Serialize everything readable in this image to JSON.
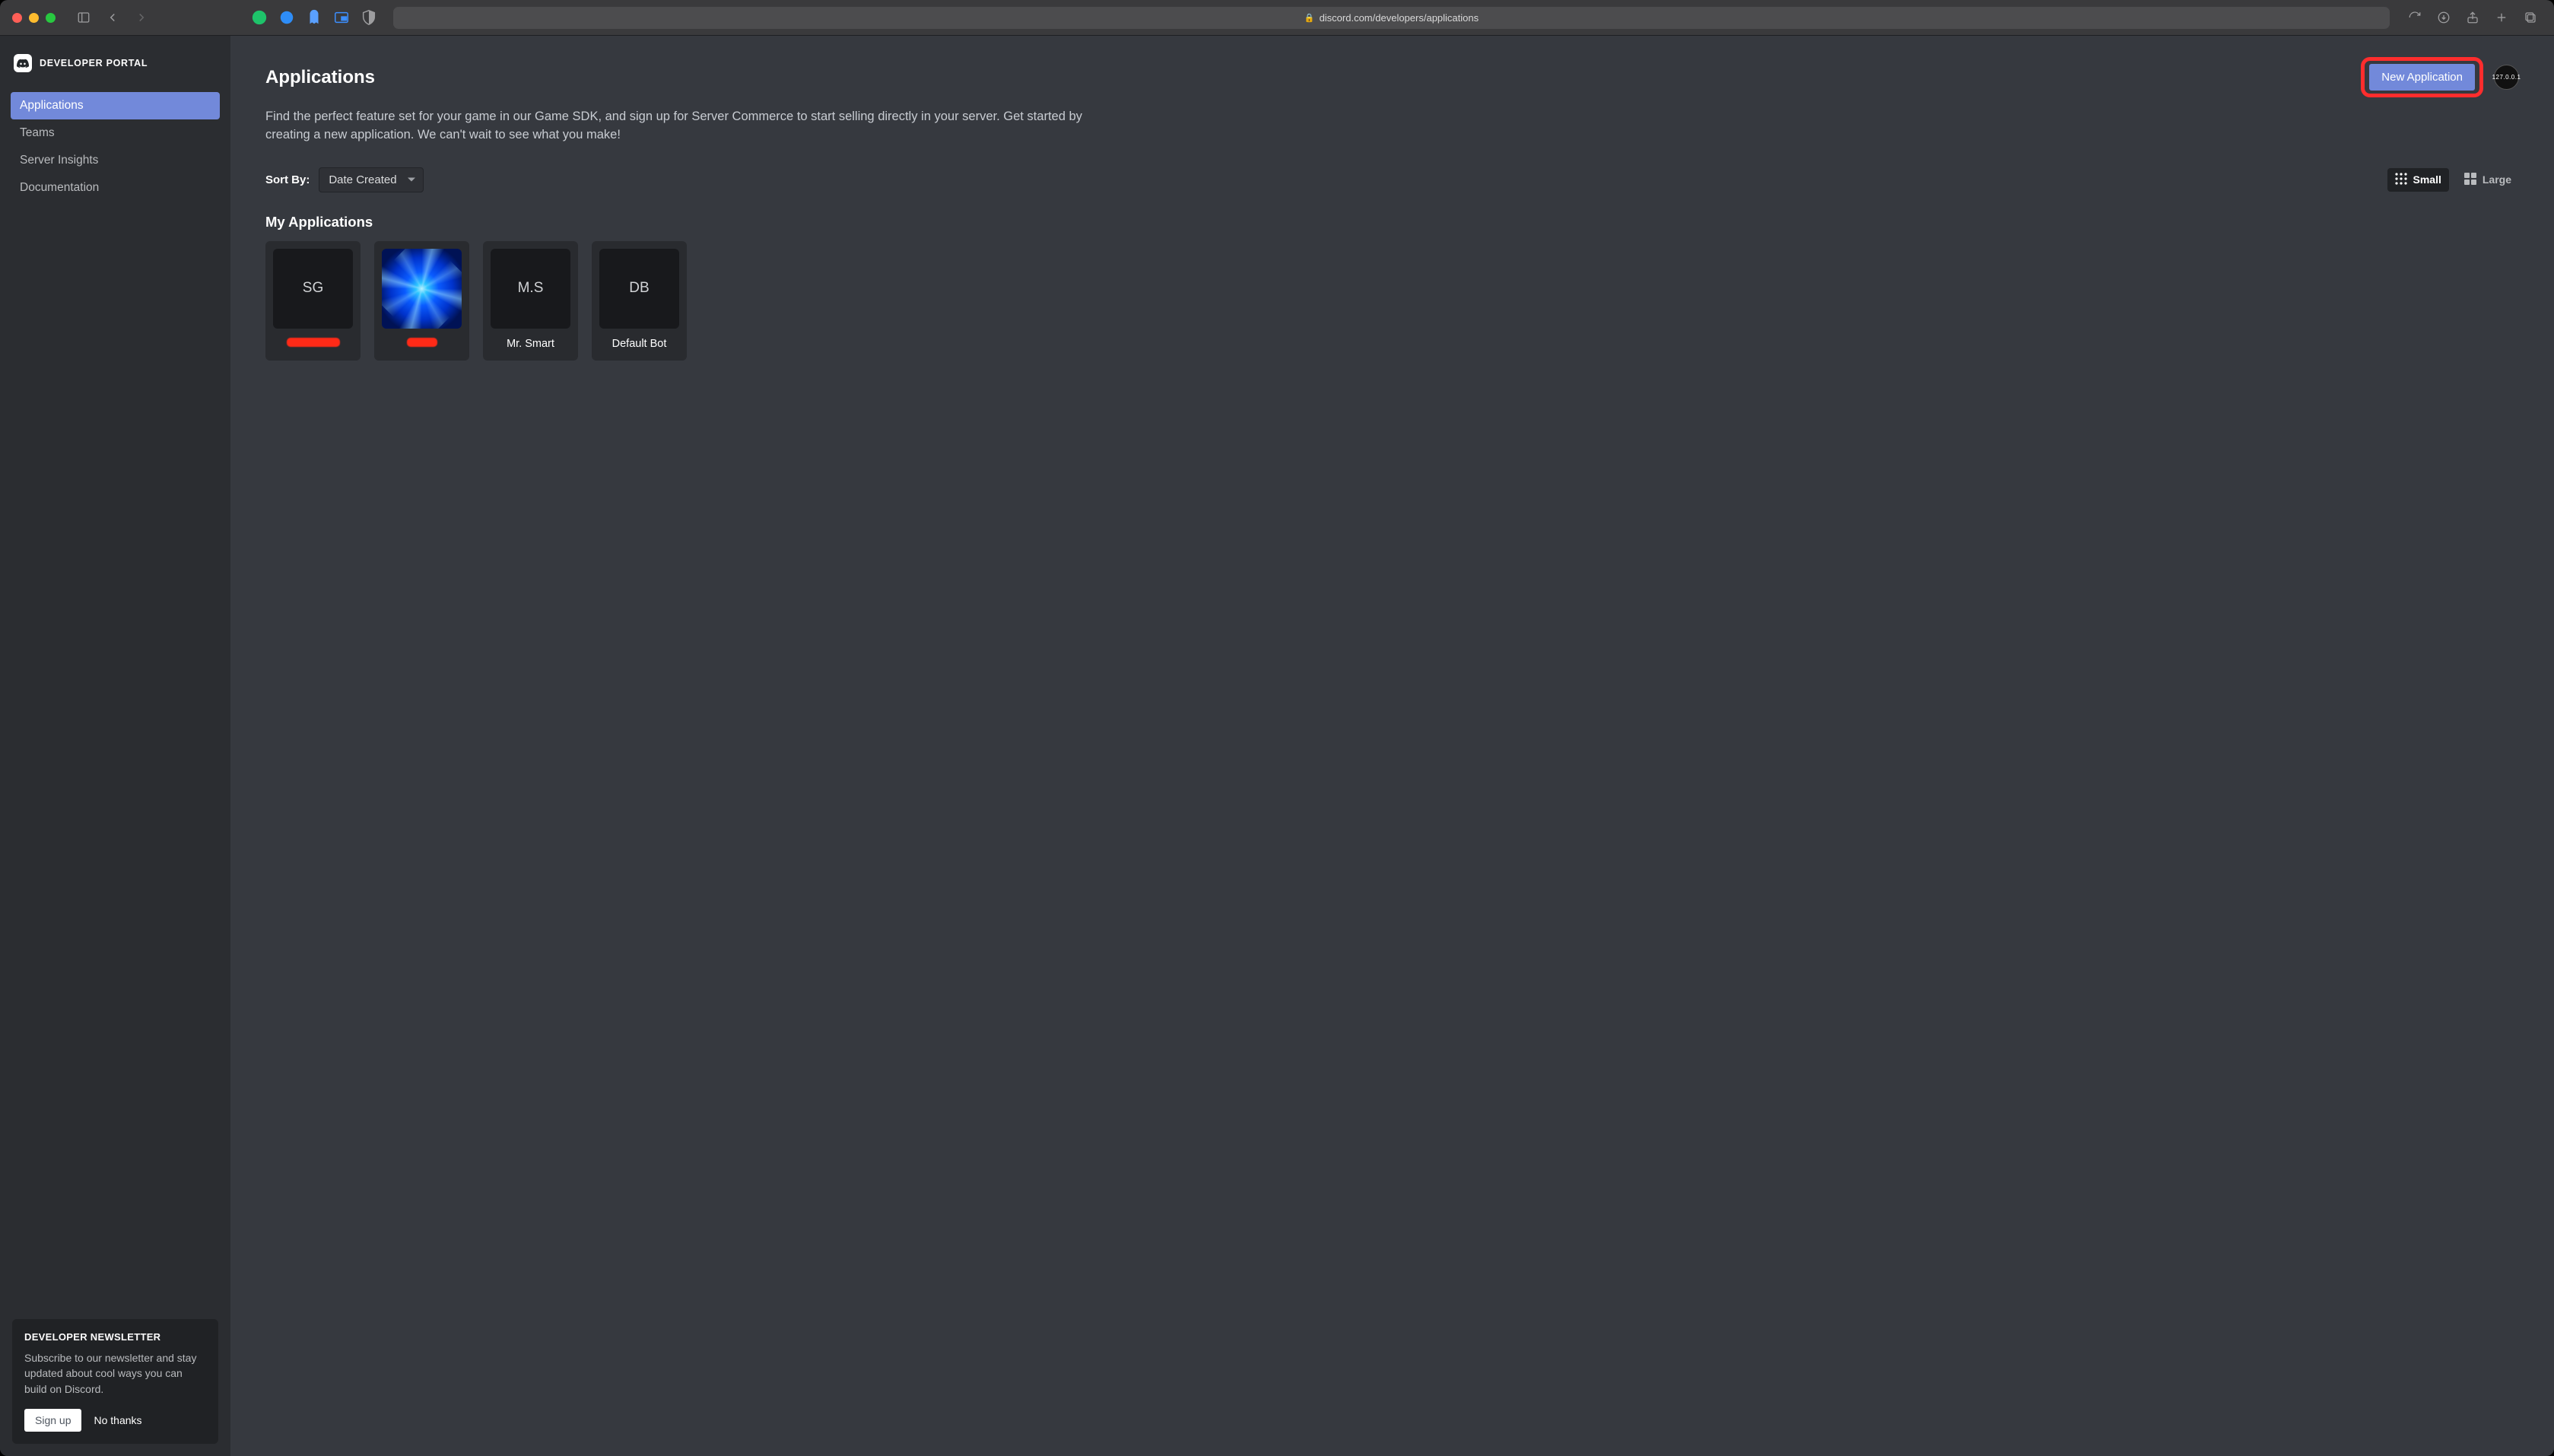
{
  "browser": {
    "url": "discord.com/developers/applications"
  },
  "sidebar": {
    "brand": "DEVELOPER PORTAL",
    "items": [
      {
        "label": "Applications",
        "active": true
      },
      {
        "label": "Teams",
        "active": false
      },
      {
        "label": "Server Insights",
        "active": false
      },
      {
        "label": "Documentation",
        "active": false
      }
    ]
  },
  "newsletter": {
    "title": "DEVELOPER NEWSLETTER",
    "body": "Subscribe to our newsletter and stay updated about cool ways you can build on Discord.",
    "signup_label": "Sign up",
    "nothanks_label": "No thanks"
  },
  "header": {
    "title": "Applications",
    "new_button": "New Application",
    "avatar_text": "127.0.0.1"
  },
  "description": "Find the perfect feature set for your game in our Game SDK, and sign up for Server Commerce to start selling directly in your server. Get started by creating a new application. We can't wait to see what you make!",
  "sort": {
    "label": "Sort By:",
    "selected": "Date Created"
  },
  "view": {
    "small_label": "Small",
    "large_label": "Large"
  },
  "section_title": "My Applications",
  "apps": [
    {
      "thumb_text": "SG",
      "name": null,
      "redacted": "large",
      "has_image": false
    },
    {
      "thumb_text": "",
      "name": null,
      "redacted": "small",
      "has_image": true
    },
    {
      "thumb_text": "M.S",
      "name": "Mr. Smart",
      "redacted": null,
      "has_image": false
    },
    {
      "thumb_text": "DB",
      "name": "Default Bot",
      "redacted": null,
      "has_image": false
    }
  ]
}
